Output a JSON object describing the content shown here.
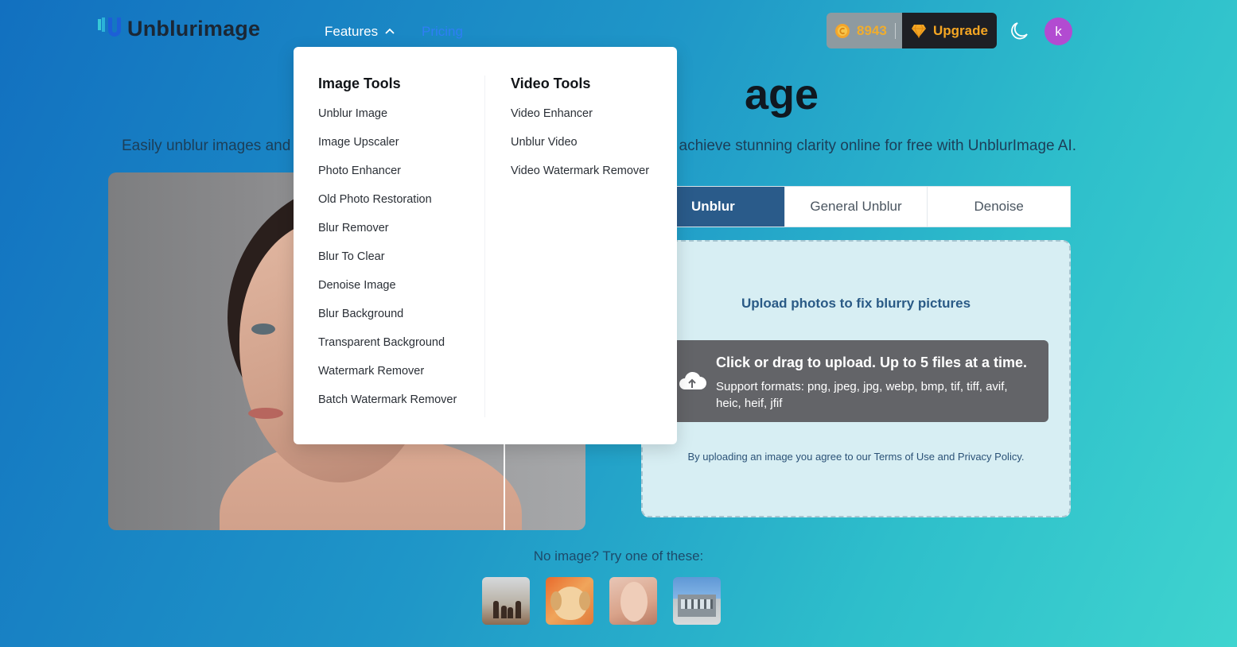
{
  "header": {
    "logo_text": "Unblurimage",
    "nav": {
      "features_label": "Features",
      "pricing_label": "Pricing"
    },
    "credits_value": "8943",
    "upgrade_label": "Upgrade",
    "avatar_initial": "k",
    "colors": {
      "pricing": "#2f7ef5",
      "credits": "#f0ad2d",
      "upgrade": "#f5a623",
      "avatar": "#b24bd1"
    }
  },
  "hero": {
    "title_visible": "age",
    "subtitle_left": "Easily unblur images and s",
    "subtitle_right": "l achieve stunning clarity online for free with UnblurImage AI."
  },
  "mode_tabs": [
    {
      "label": "Unblur",
      "active": true
    },
    {
      "label": "General Unblur",
      "active": false
    },
    {
      "label": "Denoise",
      "active": false
    }
  ],
  "upload": {
    "title": "Upload photos to fix blurry pictures",
    "main_text": "Click or drag to upload. Up to 5 files at a time.",
    "formats_text": "Support formats: png, jpeg, jpg, webp, bmp, tif, tiff, avif, heic, heif, jfif",
    "legal_text": "By uploading an image you agree to our Terms of Use and Privacy Policy.",
    "icon": "cloud-upload-icon"
  },
  "samples": {
    "label": "No image? Try one of these:",
    "items": [
      "family-beach-sample",
      "puppy-sample",
      "woman-face-sample",
      "building-sample"
    ]
  },
  "dropdown": {
    "image_tools": {
      "heading": "Image Tools",
      "items": [
        "Unblur Image",
        "Image Upscaler",
        "Photo Enhancer",
        "Old Photo Restoration",
        "Blur Remover",
        "Blur To Clear",
        "Denoise Image",
        "Blur Background",
        "Transparent Background",
        "Watermark Remover",
        "Batch Watermark Remover"
      ]
    },
    "video_tools": {
      "heading": "Video Tools",
      "items": [
        "Video Enhancer",
        "Unblur Video",
        "Video Watermark Remover"
      ]
    }
  }
}
